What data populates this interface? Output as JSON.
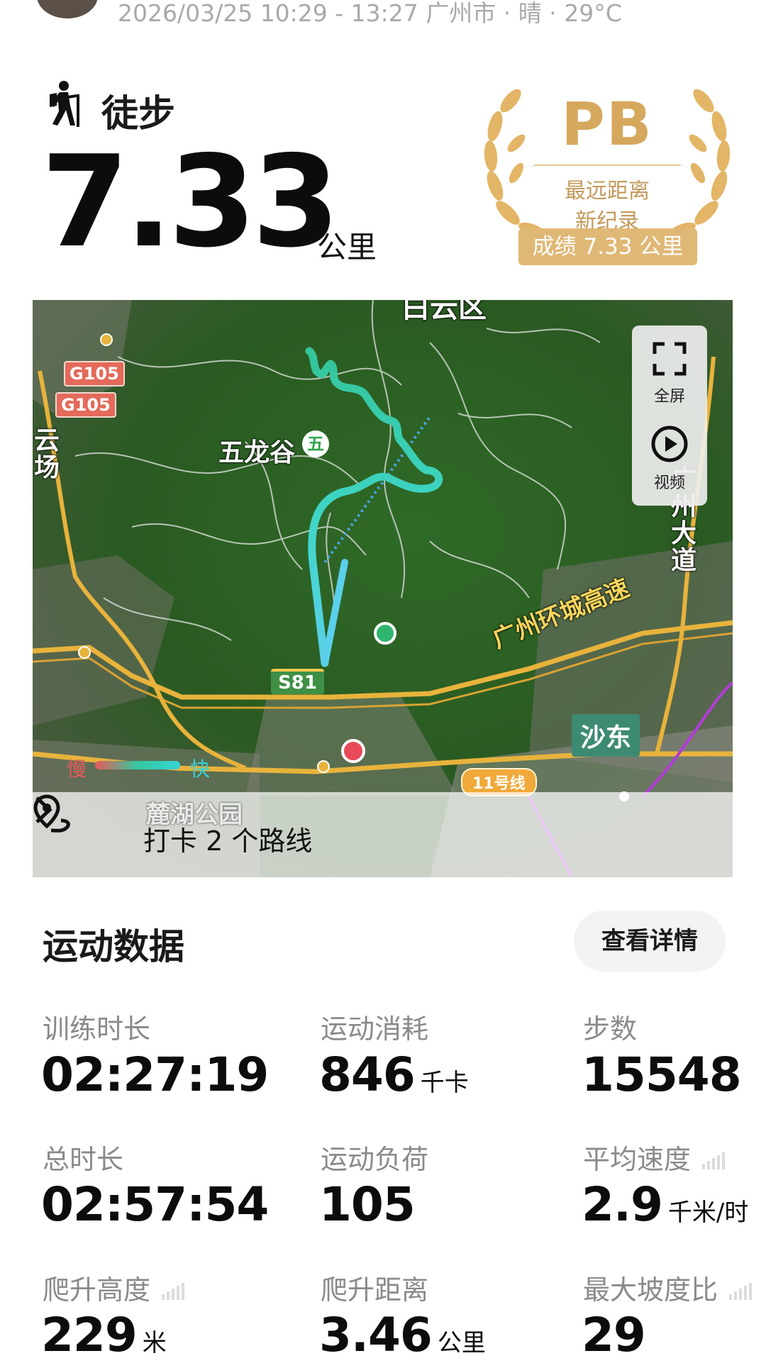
{
  "header": {
    "meta": "2026/03/25 10:29 - 13:27 广州市 · 晴 · 29°C"
  },
  "activity": {
    "icon": "hiker-icon",
    "name": "徒步",
    "distance": "7.33",
    "distance_unit": "公里"
  },
  "pb_badge": {
    "title": "PB",
    "line1": "最远距离",
    "line2": "新纪录",
    "score": "成绩 7.33 公里",
    "color": "#d6a85e"
  },
  "map": {
    "labels": {
      "wulonggu": "五龙谷",
      "wulonggu_badge": "五",
      "yunchang": "云场",
      "guangzhou_avenue": "广州大道",
      "ring_expressway": "广州环城高速",
      "shadong": "沙东",
      "top_partial": "白云区",
      "park": "麓湖公园"
    },
    "badges": {
      "g105_a": "G105",
      "g105_b": "G105",
      "s81": "S81",
      "line11": "11号线"
    },
    "controls": {
      "fullscreen_label": "全屏",
      "video_label": "视频"
    },
    "speed_legend": {
      "slow": "慢",
      "fast": "快"
    },
    "checkin": {
      "text": "打卡 2 个路线"
    }
  },
  "stats_section": {
    "title": "运动数据",
    "details_button": "查看详情",
    "items": [
      {
        "label": "训练时长",
        "value": "02:27:19",
        "unit": ""
      },
      {
        "label": "运动消耗",
        "value": "846",
        "unit": "千卡"
      },
      {
        "label": "步数",
        "value": "15548",
        "unit": ""
      },
      {
        "label": "总时长",
        "value": "02:57:54",
        "unit": ""
      },
      {
        "label": "运动负荷",
        "value": "105",
        "unit": ""
      },
      {
        "label": "平均速度",
        "value": "2.9",
        "unit": "千米/时"
      },
      {
        "label": "爬升高度",
        "value": "229",
        "unit": "米"
      },
      {
        "label": "爬升距离",
        "value": "3.46",
        "unit": "公里"
      },
      {
        "label": "最大坡度比",
        "value": "29",
        "unit": ""
      }
    ]
  }
}
